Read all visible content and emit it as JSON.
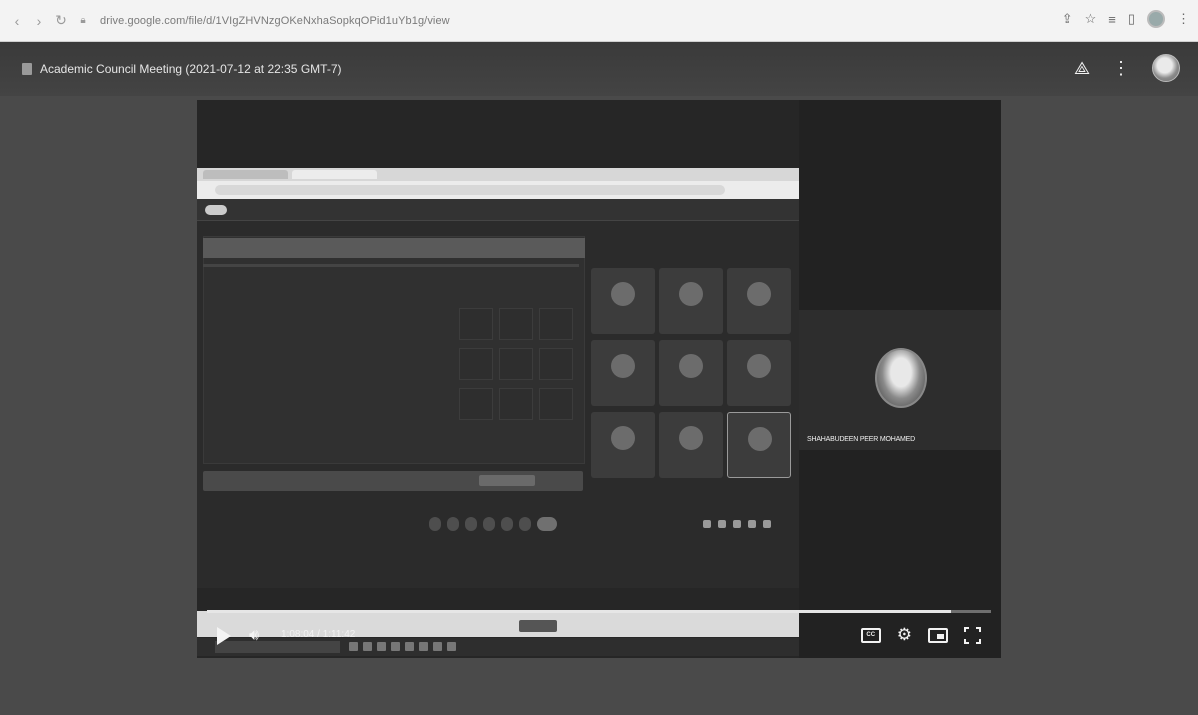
{
  "browser": {
    "url": "drive.google.com/file/d/1VIgZHVNzgOKeNxhaSopkqOPid1uYb1g/view",
    "icons": [
      "back-icon",
      "forward-icon",
      "reload-icon",
      "lock-icon",
      "share-icon",
      "star-icon",
      "reading-list-icon",
      "sidebar-icon",
      "profile-icon",
      "menu-icon"
    ]
  },
  "drive": {
    "file_title": "Academic Council Meeting (2021-07-12 at 22:35 GMT-7)",
    "icons": [
      "add-to-drive-icon",
      "more-vert-icon",
      "account-avatar"
    ]
  },
  "video": {
    "presenter_name": "SHAHABUDEEN PEER MOHAMED",
    "current_time": "1:08:04",
    "duration": "1:11:42",
    "time_display": "1:08:04 / 1:11:42",
    "progress_fraction": 0.949,
    "controls": {
      "cc_label": "CC"
    }
  }
}
